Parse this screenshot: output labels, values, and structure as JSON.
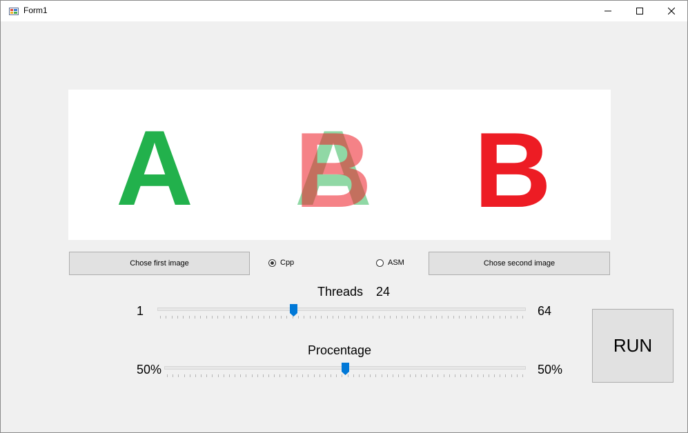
{
  "window": {
    "title": "Form1"
  },
  "titlebar_icons": [
    "app-icon",
    "minimize-icon",
    "maximize-icon",
    "close-icon"
  ],
  "buttons": {
    "first_image": "Chose first image",
    "second_image": "Chose second image",
    "run": "RUN"
  },
  "mode": {
    "options": [
      {
        "label": "Cpp",
        "selected": true
      },
      {
        "label": "ASM",
        "selected": false
      }
    ]
  },
  "threads": {
    "label": "Threads",
    "value": "24",
    "min_label": "1",
    "max_label": "64",
    "min": 1,
    "max": 64,
    "current": 24
  },
  "percentage": {
    "label": "Procentage",
    "min_label": "50%",
    "max_label": "50%",
    "level": 0.5
  },
  "preview": {
    "left_letter": "A",
    "right_letter": "B",
    "left_color": "#22b14c",
    "right_color": "#ed1c24",
    "blend_color": "#7a5a2a"
  }
}
